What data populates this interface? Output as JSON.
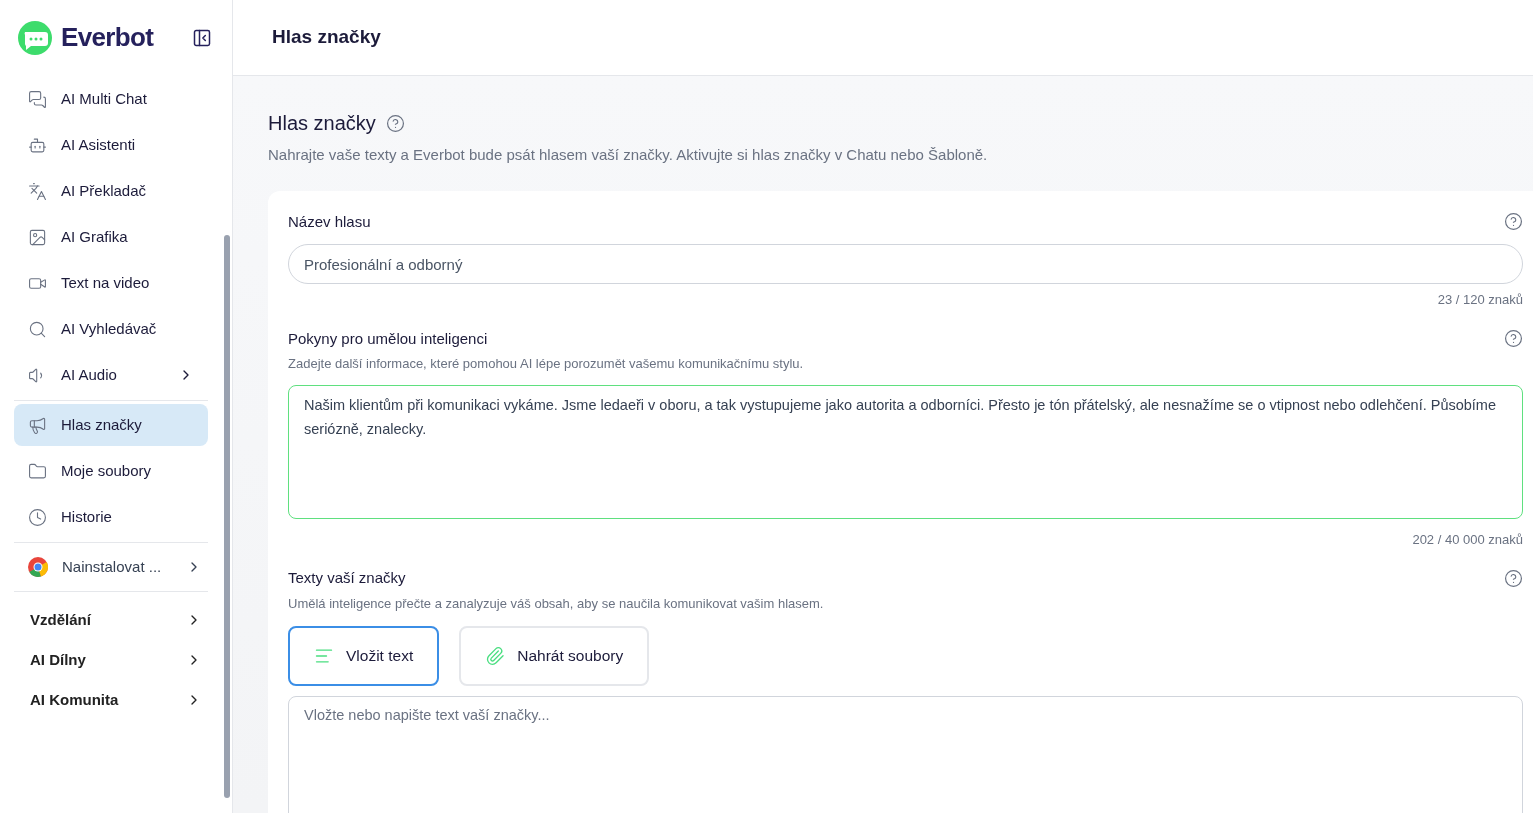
{
  "sidebar": {
    "logo": "Everbot",
    "items": [
      {
        "label": "AI Multi Chat",
        "selected": false,
        "submenu": false
      },
      {
        "label": "AI Asistenti",
        "selected": false,
        "submenu": false
      },
      {
        "label": "AI Překladač",
        "selected": false,
        "submenu": false
      },
      {
        "label": "AI Grafika",
        "selected": false,
        "submenu": false
      },
      {
        "label": "Text na video",
        "selected": false,
        "submenu": false
      },
      {
        "label": "AI Vyhledávač",
        "selected": false,
        "submenu": false
      },
      {
        "label": "AI Audio",
        "selected": false,
        "submenu": true
      },
      {
        "label": "Hlas značky",
        "selected": true,
        "submenu": false
      },
      {
        "label": "Moje soubory",
        "selected": false,
        "submenu": false
      },
      {
        "label": "Historie",
        "selected": false,
        "submenu": false
      }
    ],
    "install": {
      "label": "Nainstalovat ...",
      "submenu": true
    },
    "sections": [
      {
        "label": "Vzdělání",
        "submenu": true
      },
      {
        "label": "AI Dílny",
        "submenu": true
      },
      {
        "label": "AI Komunita",
        "submenu": true
      }
    ]
  },
  "header": {
    "title": "Hlas značky"
  },
  "page": {
    "title": "Hlas značky",
    "description": "Nahrajte vaše texty a Everbot bude psát hlasem vaší značky. Aktivujte si hlas značky v Chatu nebo Šabloně."
  },
  "name_field": {
    "label": "Název hlasu",
    "value": "Profesionální a odborný",
    "counter": "23 / 120 znaků"
  },
  "instructions_field": {
    "label": "Pokyny pro umělou inteligenci",
    "hint": "Zadejte další informace, které pomohou AI lépe porozumět vašemu komunikačnímu stylu.",
    "value": "Našim klientům při komunikaci vykáme. Jsme ledaeři v oboru, a tak vystupujeme jako autorita a odborníci. Přesto je tón přátelský, ale nesnažíme se o vtipnost nebo odlehčení. Působíme seriózně, znalecky.",
    "focused": true,
    "counter": "202 / 40 000 znaků"
  },
  "texts_field": {
    "label": "Texty vaší značky",
    "hint": "Umělá inteligence přečte a zanalyzuje váš obsah, aby se naučila komunikovat vašim hlasem.",
    "modes": [
      {
        "kind": "paste",
        "label": "Vložit text",
        "selected": true
      },
      {
        "kind": "upload",
        "label": "Nahrát soubory",
        "selected": false
      }
    ],
    "placeholder": "Vložte nebo napište text vaší značky..."
  }
}
